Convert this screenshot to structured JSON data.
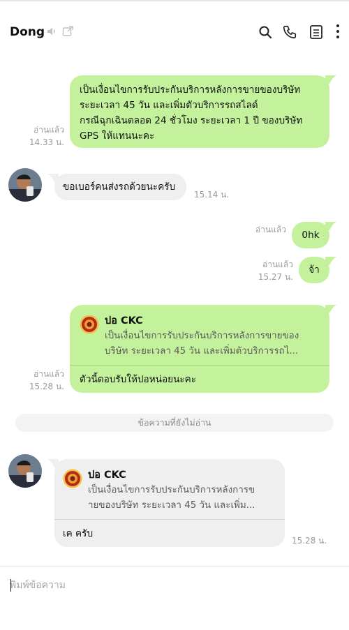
{
  "header": {
    "title": "Dong",
    "icons": [
      "speaker-mute-icon",
      "popout-icon",
      "search-icon",
      "call-icon",
      "notes-icon",
      "more-icon"
    ]
  },
  "colors": {
    "sent_bubble": "#c4f29c",
    "received_bubble": "#efefef",
    "meta_text": "#9a9a9a"
  },
  "messages": [
    {
      "direction": "sent",
      "lines": [
        "เป็นเงื่อนไขการรับประกันบริการหลังการขายของบริษัท",
        "ระยะเวลา 45 วัน  และเพิ่มตัวบริการรถสไลด์",
        "กรณีฉุกเฉินตลอด 24 ชั่วโมง ระยะเวลา 1 ปี ของบริษัท",
        "GPS ให้แทนนะคะ"
      ],
      "read": "อ่านแล้ว",
      "time": "14.33 น."
    },
    {
      "direction": "received",
      "text": "ขอเบอร์คนส่งรถด้วยนะครับ",
      "time": "15.14 น."
    },
    {
      "direction": "sent",
      "text": "0hk",
      "read": "อ่านแล้ว",
      "time": ""
    },
    {
      "direction": "sent",
      "text": "จ้า",
      "read": "อ่านแล้ว",
      "time": "15.27 น."
    },
    {
      "direction": "sent",
      "quote_name": "ปอ CKC",
      "quote_lines": [
        "เป็นเงื่อนไขการรับประกันบริการหลังการขายของ",
        "บริษัท ระยะเวลา 45 วัน  และเพิ่มตัวบริการรถไ..."
      ],
      "text": "ตัวนี้ตอบรับให้ปอหน่อยนะคะ",
      "read": "อ่านแล้ว",
      "time": "15.28 น."
    },
    {
      "direction": "received",
      "quote_name": "ปอ CKC",
      "quote_lines": [
        "เป็นเงื่อนไขการรับประกันบริการหลังการข",
        "ายของบริษัท ระยะเวลา 45 วัน  และเพิ่ม..."
      ],
      "text": "เค ครับ",
      "time": "15.28 น."
    }
  ],
  "unread_divider": "ข้อความที่ยังไม่อ่าน",
  "composer": {
    "placeholder": "พิมพ์ข้อความ",
    "value": ""
  }
}
